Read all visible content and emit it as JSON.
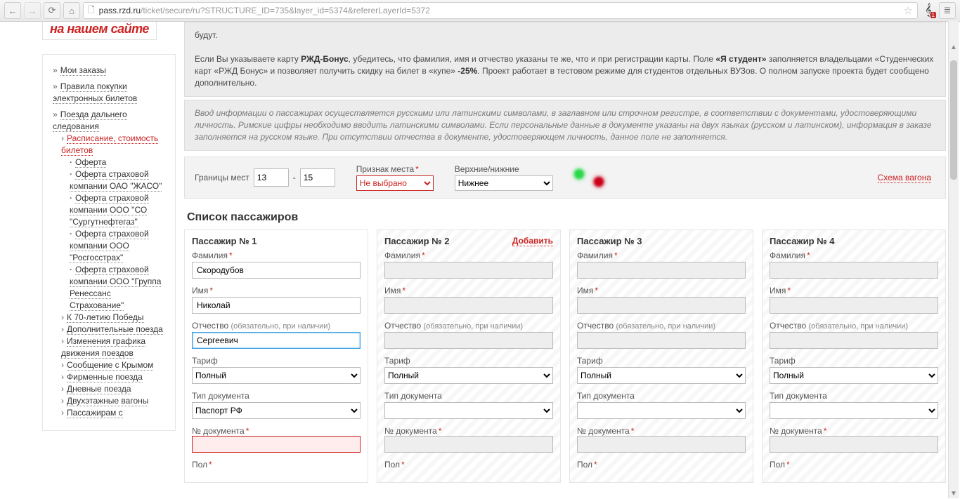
{
  "chrome": {
    "url_host": "pass.rzd.ru",
    "url_path": "/ticket/secure/ru?STRUCTURE_ID=735&layer_id=5374&refererLayerId=5372",
    "badge": "1"
  },
  "logo_fragment": "на нашем сайте",
  "sidebar": [
    {
      "label": "Мои заказы"
    },
    {
      "label": "Правила покупки электронных билетов"
    },
    {
      "label": "Поезда дальнего следования",
      "children": [
        {
          "label": "Расписание, стоимость билетов",
          "active": true,
          "children": [
            {
              "label": "Оферта"
            },
            {
              "label": "Оферта страховой компании ОАО \"ЖАСО\""
            },
            {
              "label": "Оферта страховой компании ООО \"СО \"Сургутнефтегаз\""
            },
            {
              "label": "Оферта страховой компании ООО \"Росгосстрах\""
            },
            {
              "label": "Оферта страховой компании ООО \"Группа Ренессанс Страхование\""
            }
          ]
        },
        {
          "label": "К 70-летию Победы"
        },
        {
          "label": "Дополнительные поезда"
        },
        {
          "label": "Изменения графика движения поездов"
        },
        {
          "label": "Сообщение с Крымом"
        },
        {
          "label": "Фирменные поезда"
        },
        {
          "label": "Дневные поезда"
        },
        {
          "label": "Двухэтажные вагоны"
        },
        {
          "label": "Пассажирам с"
        }
      ]
    }
  ],
  "info": {
    "p1": "будут.",
    "p2_a": "Если Вы указываете карту ",
    "p2_b": "РЖД-Бонус",
    "p2_c": ", убедитесь, что фамилия, имя и отчество указаны те же, что и при регистрации карты. Поле ",
    "p2_d": "«Я студент»",
    "p2_e": " заполняется владельцами «Студенческих карт «РЖД Бонус» и позволяет получить скидку на билет в «купе» ",
    "p2_f": "-25%",
    "p2_g": ". Проект работает в тестовом режиме для студентов отдельных ВУЗов. О полном запуске проекта будет сообщено дополнительно.",
    "p3": "Ввод информации о пассажирах осуществляется русскими или латинскими символами, в заглавном или строчном регистре, в соответствии с документами, удостоверяющими личность. Римские цифры необходимо вводить латинскими символами. Если персональные данные в документе указаны на двух языках (русском и латинском), информация в заказе заполняется на русском языке. При отсутствии отчества в документе, удостоверяющем личность, данное поле не заполняется."
  },
  "seat_bar": {
    "range_label": "Границы мест",
    "from": "13",
    "to": "15",
    "attr_label": "Признак места",
    "attr_value": "Не выбрано",
    "deck_label": "Верхние/нижние",
    "deck_value": "Нижнее",
    "wagon_link": "Схема вагона"
  },
  "passengers": {
    "section_title": "Список пассажиров",
    "add_label": "Добавить",
    "labels": {
      "surname": "Фамилия",
      "name": "Имя",
      "patronymic": "Отчество",
      "patronymic_hint": "(обязательно, при наличии)",
      "tariff": "Тариф",
      "doc_type": "Тип документа",
      "doc_num": "№ документа",
      "gender": "Пол"
    },
    "defaults": {
      "tariff": "Полный",
      "doc_type": "Паспорт РФ"
    },
    "cols": [
      {
        "title": "Пассажир № 1",
        "add": false,
        "active": true,
        "surname": "Скородубов",
        "name": "Николай",
        "patronymic": "Сергеевич",
        "tariff": "Полный",
        "doc_type": "Паспорт РФ",
        "doc_num": ""
      },
      {
        "title": "Пассажир № 2",
        "add": true,
        "active": false,
        "surname": "",
        "name": "",
        "patronymic": "",
        "tariff": "Полный",
        "doc_type": "",
        "doc_num": ""
      },
      {
        "title": "Пассажир № 3",
        "add": false,
        "active": false,
        "surname": "",
        "name": "",
        "patronymic": "",
        "tariff": "Полный",
        "doc_type": "",
        "doc_num": ""
      },
      {
        "title": "Пассажир № 4",
        "add": false,
        "active": false,
        "surname": "",
        "name": "",
        "patronymic": "",
        "tariff": "Полный",
        "doc_type": "",
        "doc_num": ""
      }
    ]
  }
}
